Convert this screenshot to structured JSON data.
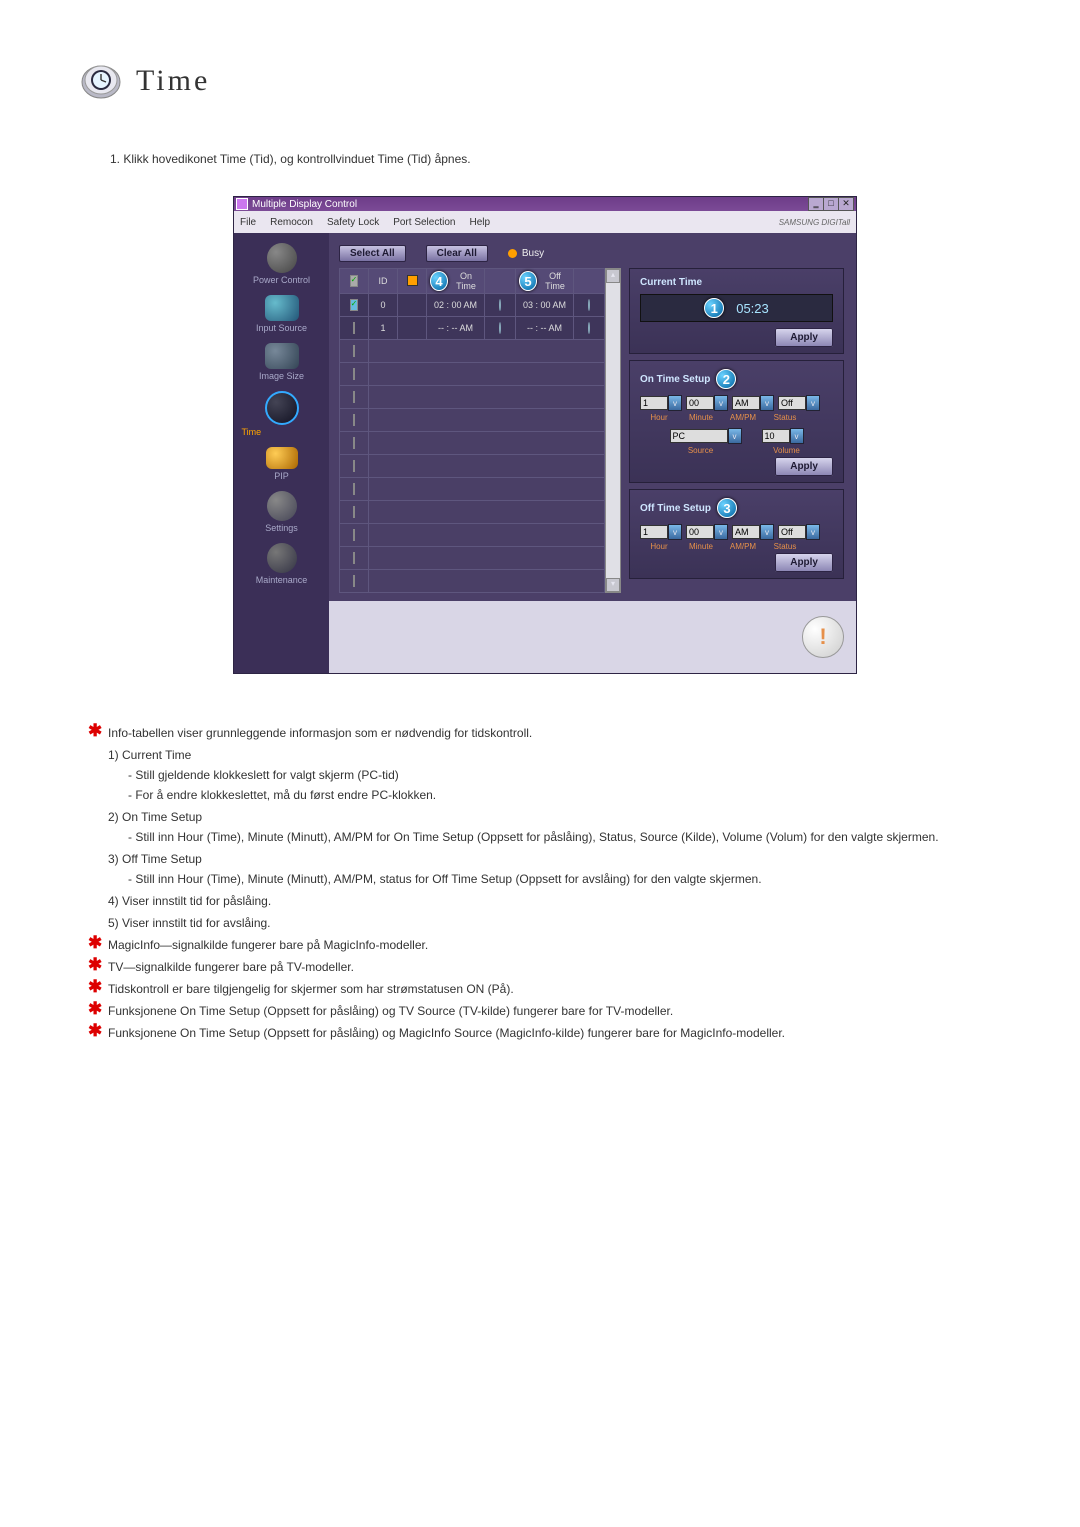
{
  "page": {
    "title": "Time",
    "intro": "1.  Klikk hovedikonet Time (Tid), og kontrollvinduet Time (Tid) åpnes."
  },
  "app": {
    "window_title": "Multiple Display Control",
    "brand": "SAMSUNG DIGITall",
    "menu": {
      "file": "File",
      "remocon": "Remocon",
      "safety": "Safety Lock",
      "port": "Port Selection",
      "help": "Help"
    }
  },
  "sidebar": {
    "power": "Power Control",
    "input": "Input Source",
    "imgsz": "Image Size",
    "time": "Time",
    "pip": "PIP",
    "settings": "Settings",
    "maint": "Maintenance"
  },
  "toolbar": {
    "select_all": "Select All",
    "clear_all": "Clear All",
    "busy": "Busy"
  },
  "table": {
    "headers": {
      "chk": "✓",
      "id": "ID",
      "stat": "",
      "ontime": "On Time",
      "offtime": "Off Time"
    },
    "callouts": {
      "ontime": "4",
      "offtime": "5"
    },
    "rows": [
      {
        "checked": true,
        "id": "0",
        "online": true,
        "ontime": "02 : 00 AM",
        "onring": true,
        "offtime": "03 : 00 AM",
        "offring": true
      },
      {
        "checked": false,
        "id": "1",
        "online": true,
        "ontime": "-- : -- AM",
        "onring": true,
        "offtime": "-- : -- AM",
        "offring": true
      }
    ]
  },
  "panels": {
    "current": {
      "title": "Current Time",
      "value": "05:23",
      "callout": "1",
      "apply": "Apply"
    },
    "on": {
      "title": "On Time Setup",
      "callout": "2",
      "hour": "1",
      "minute": "00",
      "ampm": "AM",
      "status": "Off",
      "source": "PC",
      "volume": "10",
      "labels": {
        "hour": "Hour",
        "minute": "Minute",
        "ampm": "AM/PM",
        "status": "Status",
        "source": "Source",
        "volume": "Volume"
      },
      "apply": "Apply"
    },
    "off": {
      "title": "Off Time Setup",
      "callout": "3",
      "hour": "1",
      "minute": "00",
      "ampm": "AM",
      "status": "Off",
      "labels": {
        "hour": "Hour",
        "minute": "Minute",
        "ampm": "AM/PM",
        "status": "Status"
      },
      "apply": "Apply"
    }
  },
  "notes": {
    "star1": "Info-tabellen viser grunnleggende informasjon som er nødvendig for tidskontroll.",
    "n1": "1)  Current Time",
    "n1a": "- Still gjeldende klokkeslett for valgt skjerm (PC-tid)",
    "n1b": "- For å endre klokkeslettet, må du først endre PC-klokken.",
    "n2": "2)  On Time Setup",
    "n2a": "- Still inn Hour (Time), Minute (Minutt), AM/PM for On Time Setup (Oppsett for påslåing), Status, Source (Kilde), Volume (Volum) for den valgte skjermen.",
    "n3": "3)  Off Time Setup",
    "n3a": "- Still inn Hour (Time), Minute (Minutt), AM/PM, status for Off Time Setup (Oppsett for avslåing) for den valgte skjermen.",
    "n4": "4)  Viser innstilt tid for påslåing.",
    "n5": "5)  Viser innstilt tid for avslåing.",
    "star2": "MagicInfo—signalkilde fungerer bare på MagicInfo-modeller.",
    "star3": "TV—signalkilde fungerer bare på TV-modeller.",
    "star4": "Tidskontroll er bare tilgjengelig for skjermer som har strømstatusen ON (På).",
    "star5": "Funksjonene On Time Setup (Oppsett for påslåing) og TV Source (TV-kilde) fungerer bare for TV-modeller.",
    "star6": "Funksjonene On Time Setup (Oppsett for påslåing) og MagicInfo Source (MagicInfo-kilde) fungerer bare for MagicInfo-modeller."
  }
}
